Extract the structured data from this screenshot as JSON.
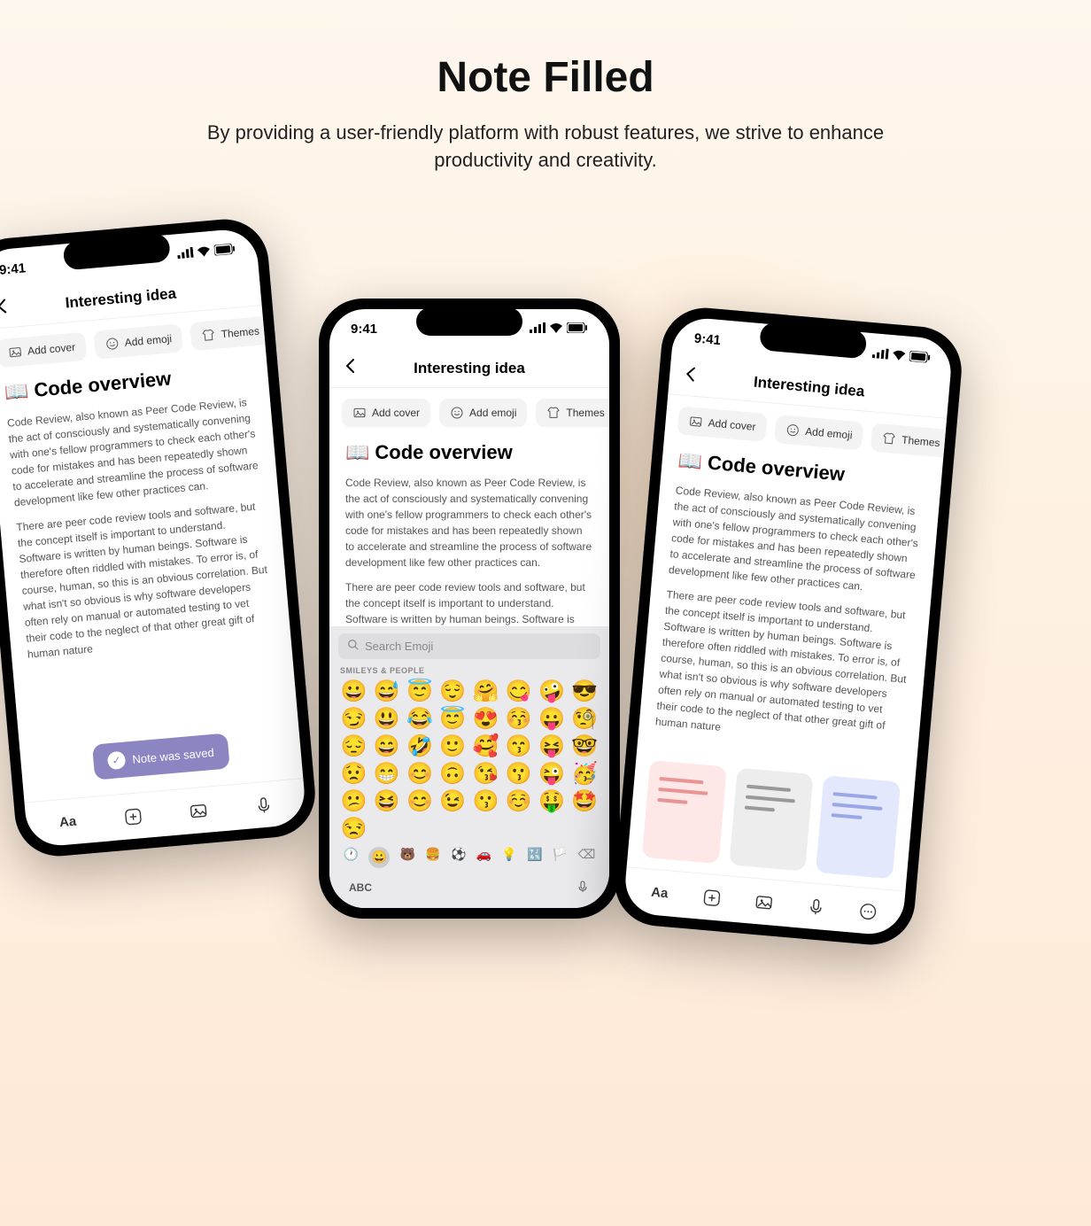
{
  "hero": {
    "title": "Note Filled",
    "subtitle": "By providing a user-friendly platform with robust features, we strive to enhance productivity and creativity."
  },
  "status": {
    "time": "9:41"
  },
  "nav": {
    "title": "Interesting idea"
  },
  "chips": {
    "add_cover": "Add cover",
    "add_emoji": "Add emoji",
    "themes": "Themes"
  },
  "note": {
    "icon": "📖",
    "heading": "Code overview",
    "p1": "Code Review, also known as Peer Code Review, is the act of consciously and systematically convening with one's fellow programmers to check each other's code for mistakes and has been repeatedly shown to accelerate and streamline the process of software development like few other practices can.",
    "p2_long": "There are peer code review tools and software, but the concept itself is important to understand. Software is written by human beings.  Software is therefore often riddled with mistakes. To error is, of course, human, so this is an obvious correlation. But what isn't so obvious is why software developers often rely on manual or automated testing to vet their code to the neglect of that other great gift of human nature",
    "p2_short": "There are peer code review tools and software, but the concept itself is important to understand. Software is written by human beings.  Software is therefore often riddled with mistakes."
  },
  "toast": {
    "label": "Note was saved"
  },
  "emoji": {
    "search_placeholder": "Search Emoji",
    "category": "SMILEYS & PEOPLE",
    "grid": [
      "😀",
      "😅",
      "😇",
      "😌",
      "🤗",
      "😋",
      "🤪",
      "😎",
      "😏",
      "😃",
      "😂",
      "😇",
      "😍",
      "😚",
      "😛",
      "🧐",
      "😔",
      "😄",
      "🤣",
      "🙂",
      "🥰",
      "😙",
      "😝",
      "🤓",
      "😟",
      "😁",
      "😊",
      "🙃",
      "😘",
      "😗",
      "😜",
      "🥳",
      "😕",
      "😆",
      "😊",
      "😉",
      "😗",
      "☺️",
      "🤑",
      "🤩",
      "😒"
    ],
    "abc": "ABC"
  },
  "bottombar": {
    "aa": "Aa"
  }
}
